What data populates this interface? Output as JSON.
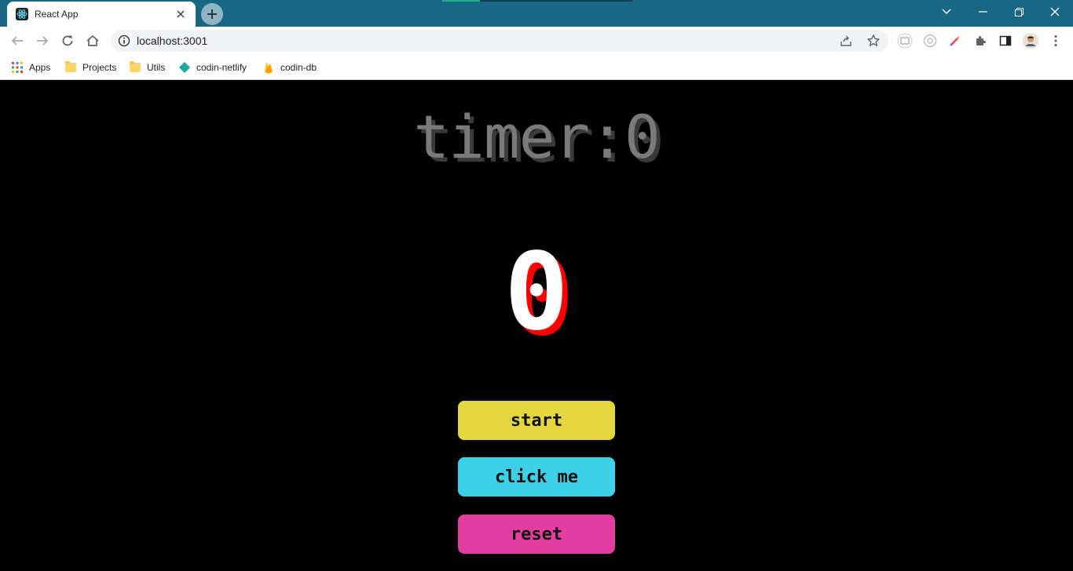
{
  "browser": {
    "tab": {
      "title": "React App"
    },
    "address": {
      "url": "localhost:3001"
    },
    "bookmarks": [
      {
        "label": "Apps",
        "icon": "apps-grid-icon"
      },
      {
        "label": "Projects",
        "icon": "folder-icon"
      },
      {
        "label": "Utils",
        "icon": "folder-icon"
      },
      {
        "label": "codin-netlify",
        "icon": "netlify-diamond-icon"
      },
      {
        "label": "codin-db",
        "icon": "firebase-icon"
      }
    ],
    "colors": {
      "titlebar": "#186784",
      "toolbar": "#ffffff"
    }
  },
  "app": {
    "heading": "timer:0",
    "counter": "0",
    "buttons": {
      "start": "start",
      "click": "click me",
      "reset": "reset"
    },
    "colors": {
      "background": "#000000",
      "start": "#e4d63f",
      "click": "#3dd0e6",
      "reset": "#e23ea0",
      "counter_shadow": "#ff0000"
    }
  }
}
